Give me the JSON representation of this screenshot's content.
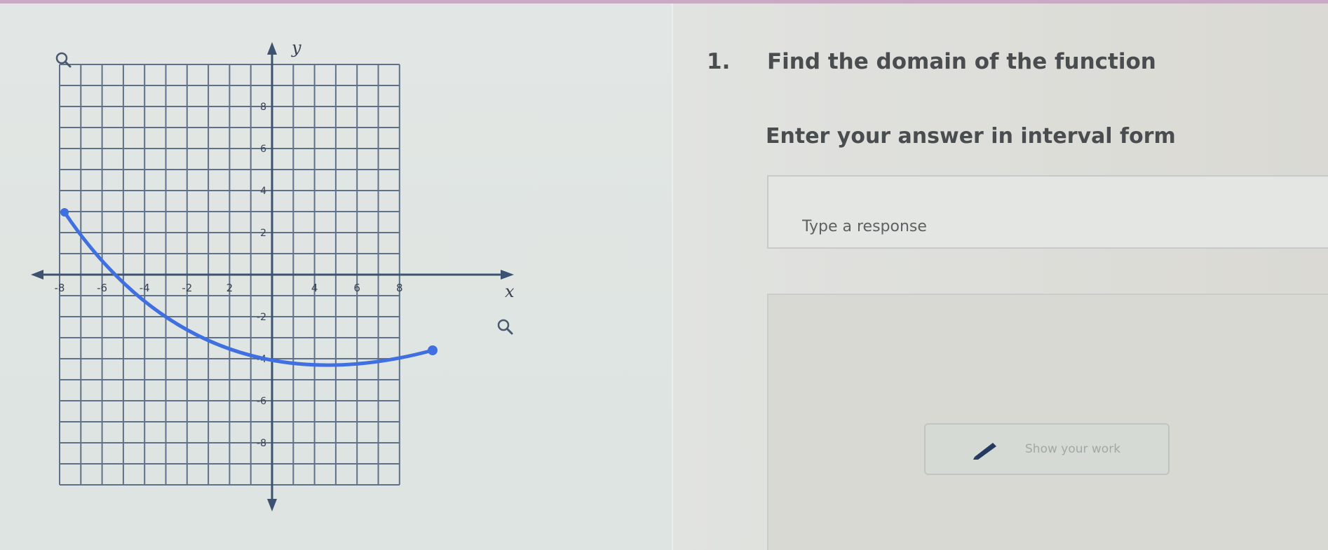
{
  "question": {
    "number": "1.",
    "text": "Find the domain of the function",
    "instruction": "Enter your answer in interval form"
  },
  "response": {
    "placeholder": "Type a response"
  },
  "work_button": {
    "label": "Show your work",
    "icon": "pencil-icon"
  },
  "graph": {
    "x_axis_label": "x",
    "y_axis_label": "y",
    "x_tick_labels": [
      "-8",
      "-6",
      "-4",
      "-2",
      "2",
      "4",
      "6",
      "8"
    ],
    "y_tick_labels": [
      "8",
      "6",
      "4",
      "2",
      "-2",
      "-4",
      "-6",
      "-8"
    ],
    "curve_color": "#3f6fe0",
    "grid_color": "#5f7189",
    "zoom_icon": "magnifier-icon"
  }
}
